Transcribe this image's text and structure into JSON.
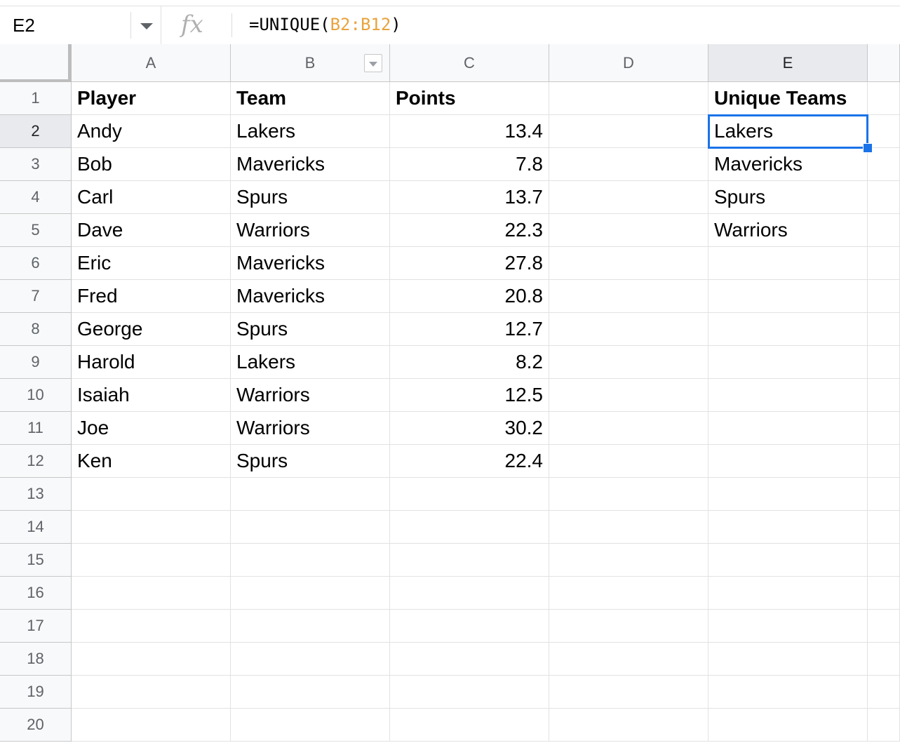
{
  "formula_bar": {
    "name_box": "E2",
    "fx_label": "fx",
    "formula_prefix": "=UNIQUE(",
    "formula_range": "B2:B12",
    "formula_suffix": ")"
  },
  "columns": [
    "A",
    "B",
    "C",
    "D",
    "E"
  ],
  "rows": [
    "1",
    "2",
    "3",
    "4",
    "5",
    "6",
    "7",
    "8",
    "9",
    "10",
    "11",
    "12",
    "13",
    "14",
    "15",
    "16",
    "17",
    "18",
    "19",
    "20"
  ],
  "selected_cell": "E2",
  "colors": {
    "selection": "#1a73e8",
    "range_ref": "#e8a33d"
  },
  "cells": {
    "headers": {
      "A": "Player",
      "B": "Team",
      "C": "Points",
      "E": "Unique Teams"
    },
    "data": [
      {
        "A": "Andy",
        "B": "Lakers",
        "C": "13.4",
        "E": "Lakers"
      },
      {
        "A": "Bob",
        "B": "Mavericks",
        "C": "7.8",
        "E": "Mavericks"
      },
      {
        "A": "Carl",
        "B": "Spurs",
        "C": "13.7",
        "E": "Spurs"
      },
      {
        "A": "Dave",
        "B": "Warriors",
        "C": "22.3",
        "E": "Warriors"
      },
      {
        "A": "Eric",
        "B": "Mavericks",
        "C": "27.8",
        "E": ""
      },
      {
        "A": "Fred",
        "B": "Mavericks",
        "C": "20.8",
        "E": ""
      },
      {
        "A": "George",
        "B": "Spurs",
        "C": "12.7",
        "E": ""
      },
      {
        "A": "Harold",
        "B": "Lakers",
        "C": "8.2",
        "E": ""
      },
      {
        "A": "Isaiah",
        "B": "Warriors",
        "C": "12.5",
        "E": ""
      },
      {
        "A": "Joe",
        "B": "Warriors",
        "C": "30.2",
        "E": ""
      },
      {
        "A": "Ken",
        "B": "Spurs",
        "C": "22.4",
        "E": ""
      }
    ]
  }
}
